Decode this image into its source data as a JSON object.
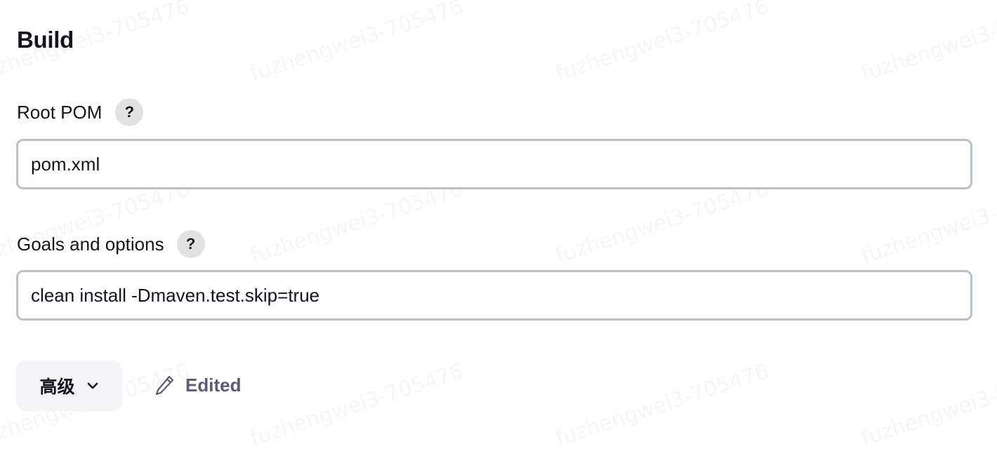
{
  "section": {
    "title": "Build"
  },
  "fields": [
    {
      "label": "Root POM",
      "help_label": "?",
      "value": "pom.xml"
    },
    {
      "label": "Goals and options",
      "help_label": "?",
      "value": "clean install -Dmaven.test.skip=true"
    }
  ],
  "advanced": {
    "label": "高级",
    "icon": "chevron-down-icon"
  },
  "status": {
    "icon": "pencil-icon",
    "label": "Edited"
  },
  "watermark": {
    "text": "fuzhengwei3-705476"
  },
  "colors": {
    "text": "#14141f",
    "input_border": "#b9c1c7",
    "help_bg": "#e2e2e2",
    "advanced_bg": "#f3f3f8",
    "edited_text": "#5b5a78"
  }
}
